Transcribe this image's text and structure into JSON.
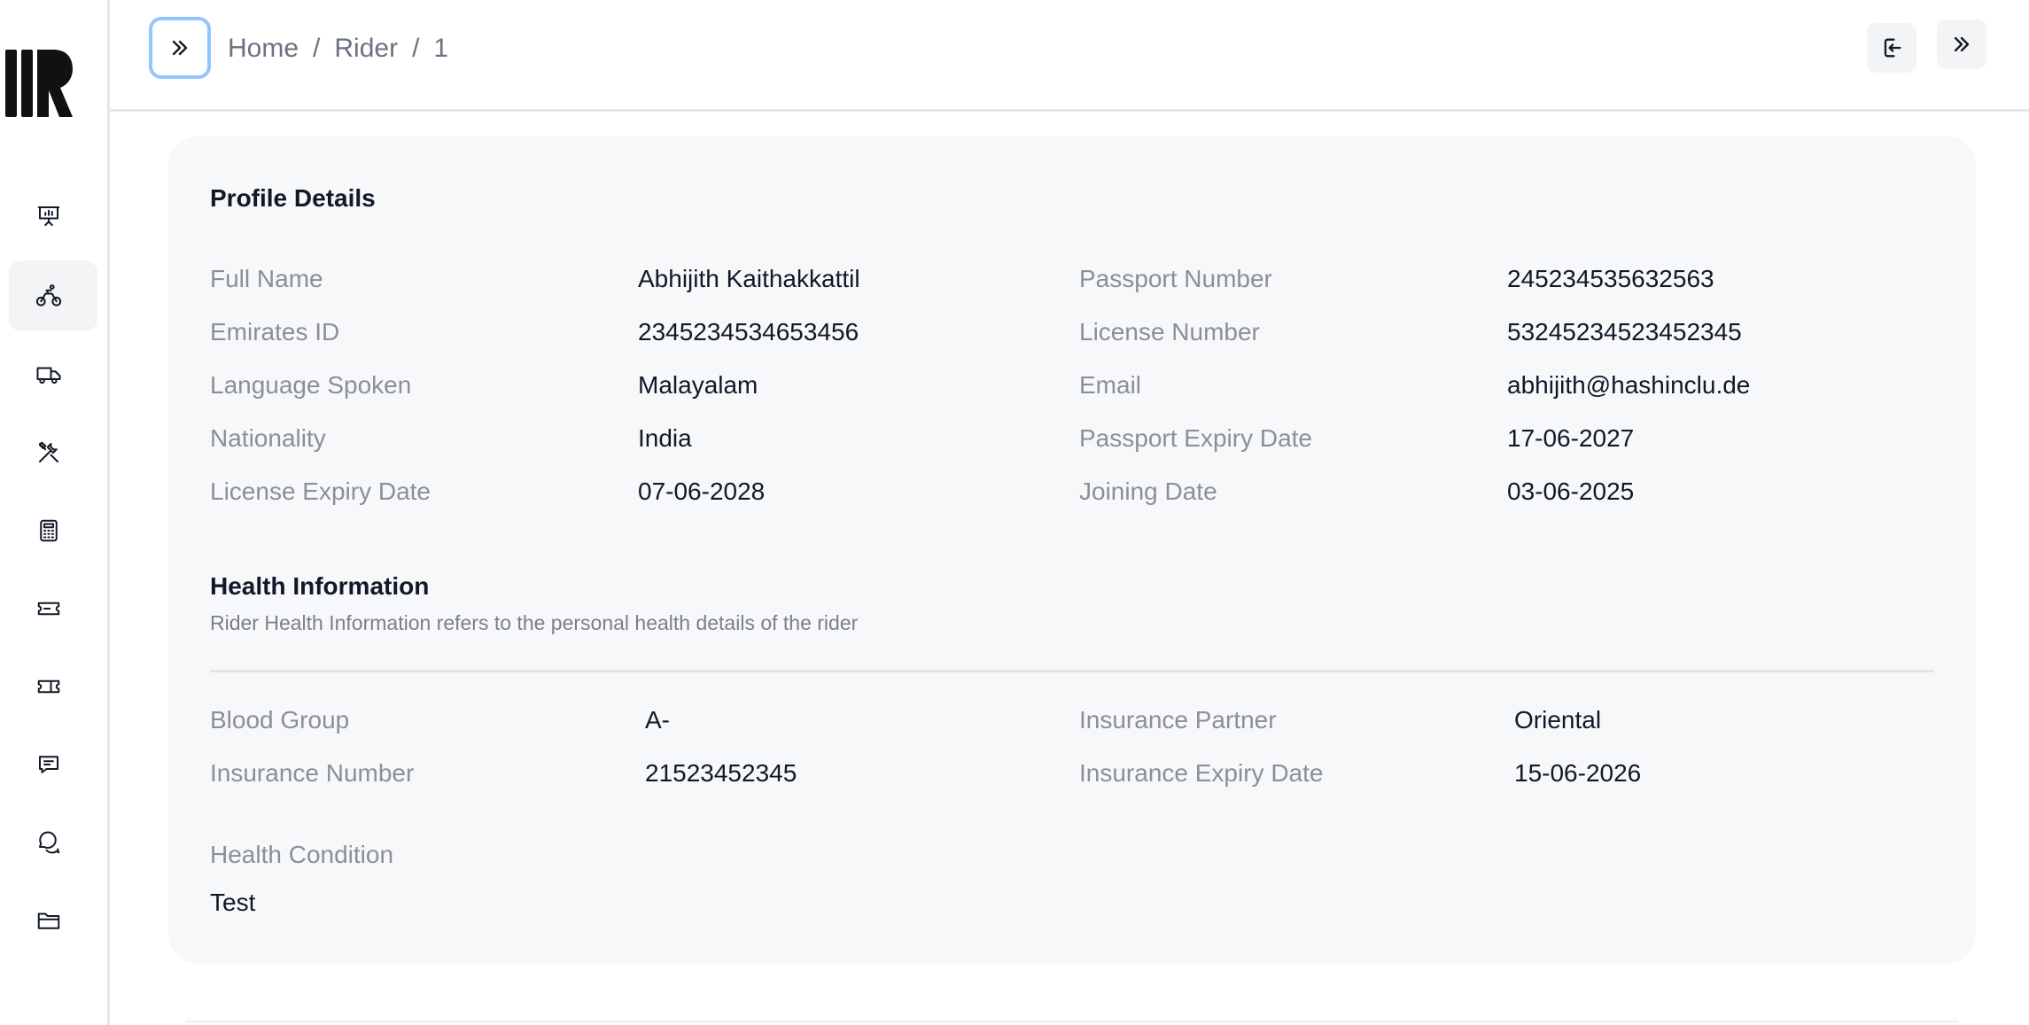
{
  "breadcrumb": {
    "home": "Home",
    "rider": "Rider",
    "id": "1",
    "separator": "/"
  },
  "sidebar": {
    "items": [
      {
        "icon": "presentation-chart-icon",
        "active": false
      },
      {
        "icon": "bicycle-rider-icon",
        "active": true
      },
      {
        "icon": "truck-icon",
        "active": false
      },
      {
        "icon": "tools-icon",
        "active": false
      },
      {
        "icon": "calculator-icon",
        "active": false
      },
      {
        "icon": "ticket-icon",
        "active": false
      },
      {
        "icon": "ticket-alt-icon",
        "active": false
      },
      {
        "icon": "message-icon",
        "active": false
      },
      {
        "icon": "chat-bubbles-icon",
        "active": false
      },
      {
        "icon": "folder-icon",
        "active": false
      }
    ]
  },
  "header_actions": {
    "logout_icon": "logout-icon",
    "expand_icon": "chevrons-right-icon"
  },
  "profile": {
    "title": "Profile Details",
    "left": [
      {
        "label": "Full Name",
        "value": "Abhijith Kaithakkattil"
      },
      {
        "label": "Emirates ID",
        "value": "2345234534653456"
      },
      {
        "label": "Language Spoken",
        "value": "Malayalam"
      },
      {
        "label": "Nationality",
        "value": "India"
      },
      {
        "label": "License Expiry Date",
        "value": "07-06-2028"
      }
    ],
    "right": [
      {
        "label": "Passport Number",
        "value": "245234535632563"
      },
      {
        "label": "License Number",
        "value": "53245234523452345"
      },
      {
        "label": "Email",
        "value": "abhijith@hashinclu.de"
      },
      {
        "label": "Passport Expiry Date",
        "value": "17-06-2027"
      },
      {
        "label": "Joining Date",
        "value": "03-06-2025"
      }
    ]
  },
  "health": {
    "title": "Health Information",
    "description": "Rider Health Information refers to the personal health details of the rider",
    "left": [
      {
        "label": "Blood Group",
        "value": "A-"
      },
      {
        "label": "Insurance Number",
        "value": "21523452345"
      }
    ],
    "right": [
      {
        "label": "Insurance Partner",
        "value": "Oriental"
      },
      {
        "label": "Insurance Expiry Date",
        "value": "15-06-2026"
      }
    ],
    "condition": {
      "label": "Health Condition",
      "value": "Test"
    }
  }
}
